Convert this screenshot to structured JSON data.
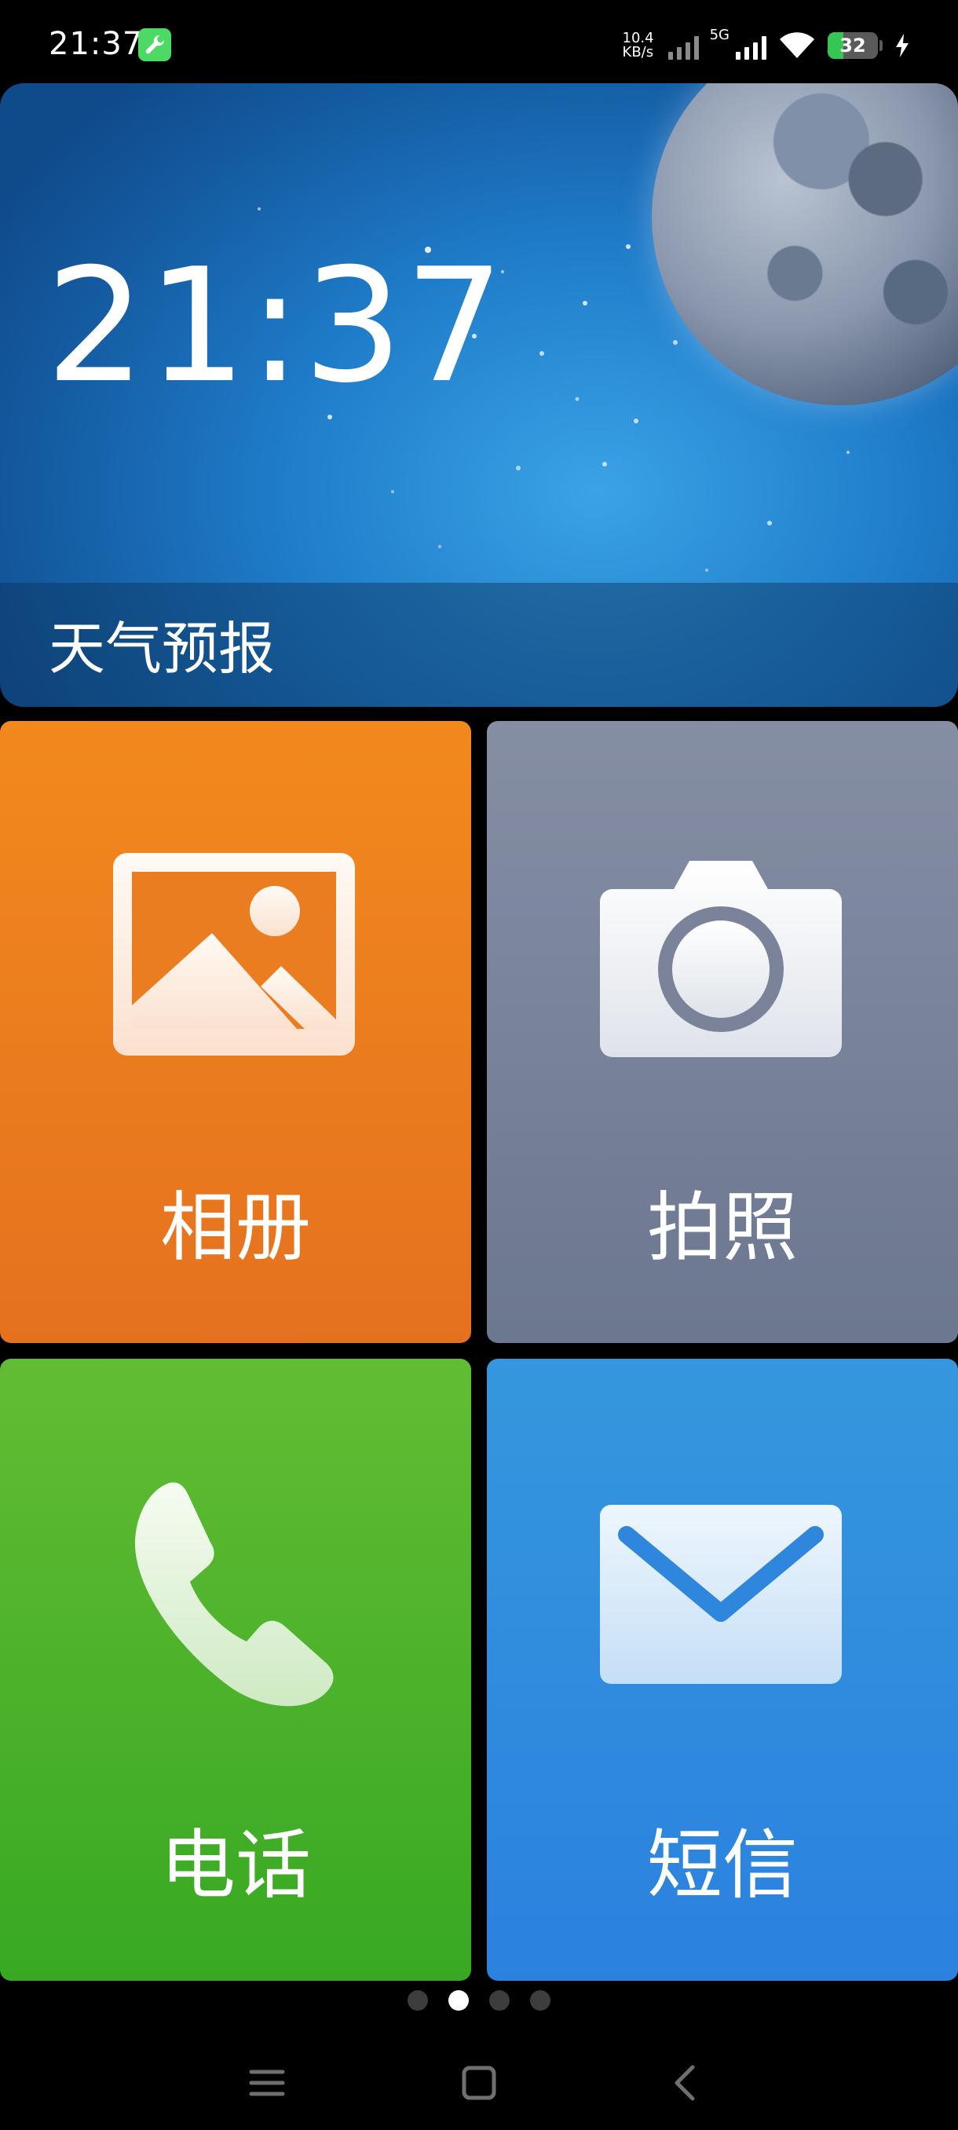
{
  "status_bar": {
    "time": "21:37",
    "net_speed_value": "10.4",
    "net_speed_unit": "KB/s",
    "network_type": "5G",
    "battery_level": "32",
    "battery_fraction": 0.32,
    "app_icon": "wrench-icon",
    "icons": [
      "signal-icon",
      "signal-5g-icon",
      "wifi-icon",
      "battery-icon",
      "charging-icon"
    ]
  },
  "weather_card": {
    "time": "21:37",
    "label": "天气预报",
    "background": "night-sky-with-moon"
  },
  "tiles": [
    {
      "label": "相册",
      "icon": "gallery-icon",
      "color": "#EE831D"
    },
    {
      "label": "拍照",
      "icon": "camera-icon",
      "color": "#7A8399"
    },
    {
      "label": "电话",
      "icon": "phone-icon",
      "color": "#4DB22B"
    },
    {
      "label": "短信",
      "icon": "message-icon",
      "color": "#308CDE"
    }
  ],
  "pager": {
    "total": 4,
    "active_index": 1
  },
  "nav_bar": {
    "buttons": [
      "menu-icon",
      "home-icon",
      "back-icon"
    ]
  }
}
